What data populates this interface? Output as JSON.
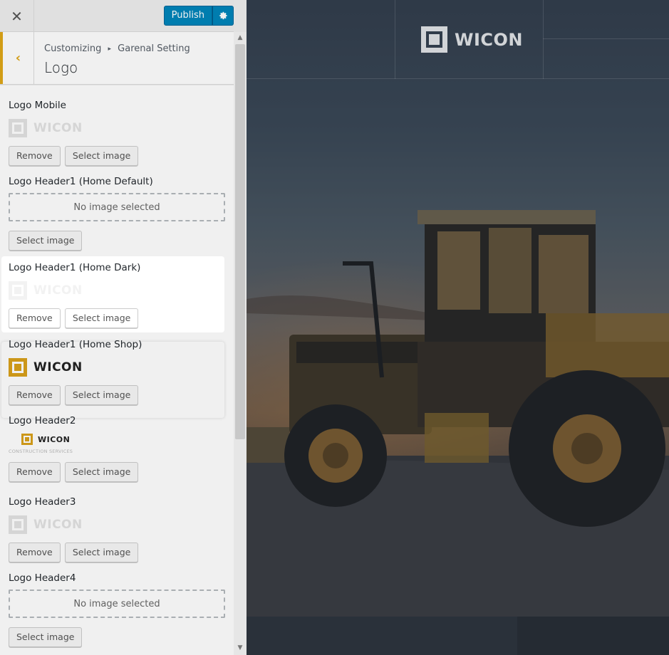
{
  "topbar": {
    "close_icon": "✕",
    "publish_label": "Publish",
    "settings_icon": "gear-icon"
  },
  "header": {
    "back_icon": "‹",
    "breadcrumb_root": "Customizing",
    "breadcrumb_separator": "▸",
    "breadcrumb_section": "Garenal Setting",
    "title": "Logo"
  },
  "controls": [
    {
      "label": "Logo Mobile",
      "has_image": true,
      "logo_text": "WICON",
      "remove_label": "Remove",
      "select_label": "Select image"
    },
    {
      "label": "Logo Header1 (Home Default)",
      "has_image": false,
      "placeholder": "No image selected",
      "select_label": "Select image"
    },
    {
      "label": "Logo Header1 (Home Dark)",
      "has_image": true,
      "logo_text": "WICON",
      "remove_label": "Remove",
      "select_label": "Select image"
    },
    {
      "label": "Logo Header1 (Home Shop)",
      "has_image": true,
      "logo_text": "WICON",
      "remove_label": "Remove",
      "select_label": "Select image"
    },
    {
      "label": "Logo Header2",
      "has_image": true,
      "logo_text": "WICON",
      "logo_tagline": "CONSTRUCTION SERVICES",
      "remove_label": "Remove",
      "select_label": "Select image"
    },
    {
      "label": "Logo Header3",
      "has_image": true,
      "logo_text": "WICON",
      "remove_label": "Remove",
      "select_label": "Select image"
    },
    {
      "label": "Logo Header4",
      "has_image": false,
      "placeholder": "No image selected",
      "select_label": "Select image"
    }
  ],
  "preview": {
    "logo_text": "WICON"
  },
  "colors": {
    "accent": "#e0a718",
    "primary": "#0085ba",
    "logo_gold": "#d9a11b"
  }
}
